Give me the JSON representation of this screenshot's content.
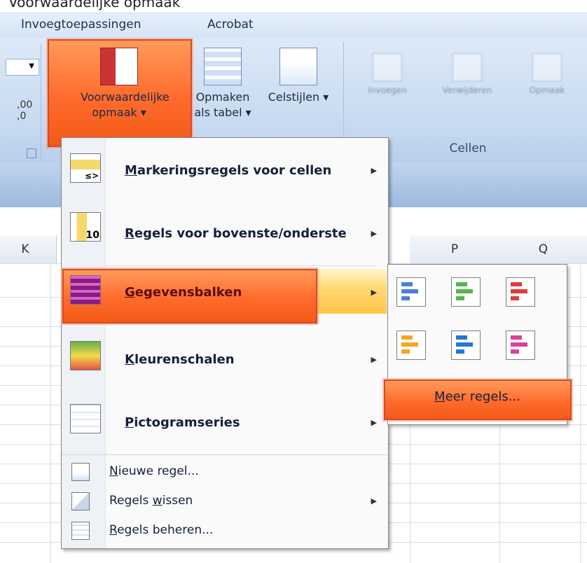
{
  "top_text": "Voorwaardelijke opmaak",
  "tabs": [
    {
      "label": "Invoegtoepassingen"
    },
    {
      "label": "Acrobat"
    }
  ],
  "ribbon": {
    "number_format_label": ",00 ,0",
    "buttons": [
      {
        "label": "Voorwaardelijke opmaak ▾"
      },
      {
        "label": "Opmaken als tabel ▾"
      },
      {
        "label": "Celstijlen ▾"
      },
      {
        "label": "Invoegen"
      },
      {
        "label": "Verwijderen"
      },
      {
        "label": "Opmaak"
      }
    ],
    "group_label": "Cellen"
  },
  "sheet": {
    "columns": [
      "K",
      "P",
      "Q"
    ]
  },
  "menu": {
    "items": [
      {
        "label": "Markeringsregels voor cellen",
        "underline": "M",
        "icon": "highlight-cells-icon",
        "has_submenu": true
      },
      {
        "label": "Regels voor bovenste/onderste",
        "underline": "R",
        "icon": "top-bottom-rules-icon",
        "has_submenu": true
      },
      {
        "label": "Gegevensbalken",
        "underline": "G",
        "icon": "data-bars-icon",
        "has_submenu": true,
        "highlighted": true
      },
      {
        "label": "Kleurenschalen",
        "underline": "K",
        "icon": "color-scales-icon",
        "has_submenu": true
      },
      {
        "label": "Pictogramseries",
        "underline": "P",
        "icon": "icon-sets-icon",
        "has_submenu": true
      }
    ],
    "small_items": [
      {
        "label": "Nieuwe regel...",
        "underline": "N",
        "icon": "new-rule-icon",
        "has_submenu": false
      },
      {
        "label": "Regels wissen",
        "underline": "w",
        "icon": "clear-rules-icon",
        "has_submenu": true
      },
      {
        "label": "Regels beheren...",
        "underline": "R",
        "icon": "manage-rules-icon",
        "has_submenu": false
      }
    ],
    "top_bottom_number": "10",
    "compare_glyph": "≤>",
    "arrow_glyph": "▶"
  },
  "submenu": {
    "data_bar_colors": [
      "#4f7fd0",
      "#53b848",
      "#e23b3b",
      "#f5a623",
      "#2477d4",
      "#d9409f"
    ],
    "more_rules_label": "Meer regels...",
    "more_rules_underline": "M"
  },
  "colors": {
    "highlight": "#ff6b2d",
    "accent": "#d84a24"
  }
}
